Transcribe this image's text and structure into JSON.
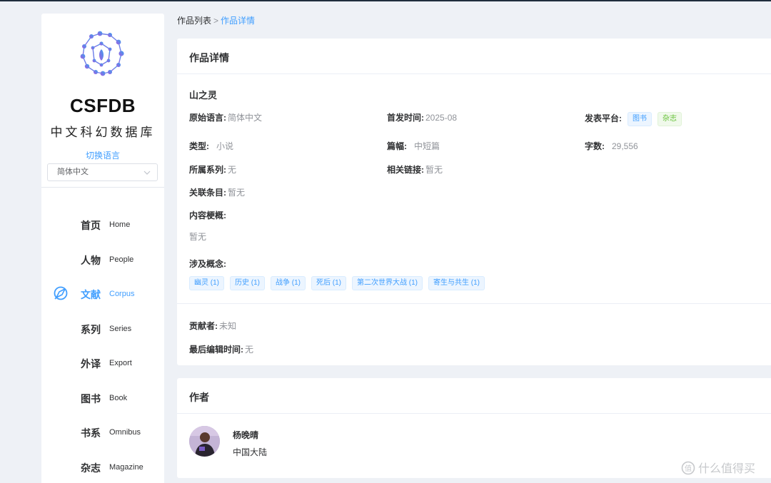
{
  "breadcrumb": {
    "parent": "作品列表",
    "current": "作品详情"
  },
  "sidebar": {
    "brand": "CSFDB",
    "brand_subtitle": "中文科幻数据库",
    "language_label": "切换语言",
    "language_selected": "简体中文",
    "items": [
      {
        "zh": "首页",
        "en": "Home",
        "active": false
      },
      {
        "zh": "人物",
        "en": "People",
        "active": false
      },
      {
        "zh": "文献",
        "en": "Corpus",
        "active": true,
        "icon": "compass-icon"
      },
      {
        "zh": "系列",
        "en": "Series",
        "active": false
      },
      {
        "zh": "外译",
        "en": "Export",
        "active": false
      },
      {
        "zh": "图书",
        "en": "Book",
        "active": false
      },
      {
        "zh": "书系",
        "en": "Omnibus",
        "active": false
      },
      {
        "zh": "杂志",
        "en": "Magazine",
        "active": false
      }
    ]
  },
  "detail": {
    "header": "作品详情",
    "title": "山之灵",
    "original_language": {
      "label": "原始语言:",
      "value": "简体中文"
    },
    "first_published": {
      "label": "首发时间:",
      "value": "2025-08"
    },
    "platform": {
      "label": "发表平台:",
      "tags": [
        "图书",
        "杂志"
      ]
    },
    "type": {
      "label": "类型:",
      "value": "小说"
    },
    "length": {
      "label": "篇幅:",
      "value": "中短篇"
    },
    "word_count": {
      "label": "字数:",
      "value": "29,556"
    },
    "series": {
      "label": "所属系列:",
      "value": "无"
    },
    "related_links": {
      "label": "相关链接:",
      "value": "暂无"
    },
    "related_entries": {
      "label": "关联条目:",
      "value": "暂无"
    },
    "synopsis": {
      "label": "内容梗概:",
      "value": "暂无"
    },
    "concepts": {
      "label": "涉及概念:",
      "tags": [
        "幽灵 (1)",
        "历史 (1)",
        "战争 (1)",
        "死后 (1)",
        "第二次世界大战 (1)",
        "寄生与共生 (1)"
      ]
    },
    "contributor": {
      "label": "贡献者:",
      "value": "未知"
    },
    "last_edited": {
      "label": "最后编辑时间:",
      "value": "无"
    }
  },
  "author_card": {
    "header": "作者",
    "name": "杨晚晴",
    "region": "中国大陆"
  },
  "watermark": "什么值得买",
  "colors": {
    "accent": "#409eff",
    "tag_green": "#67c23a",
    "page_bg": "#eef1f6"
  }
}
